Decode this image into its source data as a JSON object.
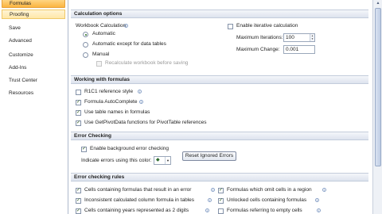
{
  "nav": {
    "items": [
      {
        "label": "Formulas",
        "state": "active"
      },
      {
        "label": "Proofing",
        "state": "hover"
      },
      {
        "label": "Save",
        "state": ""
      },
      {
        "label": "Advanced",
        "state": ""
      },
      {
        "label": "Customize",
        "state": ""
      },
      {
        "label": "Add-Ins",
        "state": ""
      },
      {
        "label": "Trust Center",
        "state": ""
      },
      {
        "label": "Resources",
        "state": ""
      }
    ]
  },
  "calc": {
    "header": "Calculation options",
    "workbook_label": "Workbook Calculation",
    "automatic": "Automatic",
    "automatic_except": "Automatic except for data tables",
    "manual": "Manual",
    "recalc_before_save": "Recalculate workbook before saving",
    "enable_iterative": "Enable iterative calculation",
    "max_iterations_label": "Maximum Iterations:",
    "max_iterations_value": "100",
    "max_change_label": "Maximum Change:",
    "max_change_value": "0.001",
    "selected": "Automatic"
  },
  "formulas": {
    "header": "Working with formulas",
    "r1c1": "R1C1 reference style",
    "autocomplete": "Formula AutoComplete",
    "table_names": "Use table names in formulas",
    "getpivotdata": "Use GetPivotData functions for PivotTable references"
  },
  "errchk": {
    "header": "Error Checking",
    "enable_bg": "Enable background error checking",
    "indicate_label": "Indicate errors using this color:",
    "reset_button": "Reset Ignored Errors",
    "error_color": "#2c6b2c"
  },
  "rules": {
    "header": "Error checking rules",
    "left": [
      "Cells containing formulas that result in an error",
      "Inconsistent calculated column formula in tables",
      "Cells containing years represented as 2 digits"
    ],
    "right": [
      "Formulas which omit cells in a region",
      "Unlocked cells containing formulas",
      "Formulas referring to empty cells"
    ]
  },
  "icons": {
    "info": "info-icon",
    "check": "checkmark-icon",
    "scroll_up": "scroll-up-arrow-icon"
  }
}
